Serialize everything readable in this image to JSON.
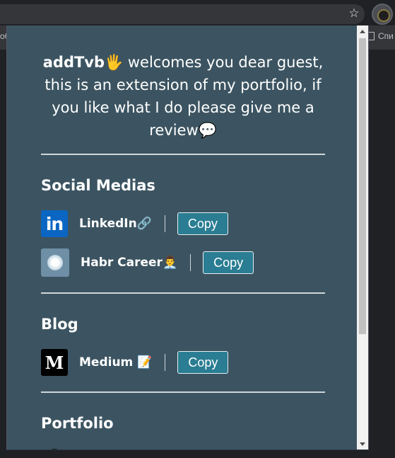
{
  "browser": {
    "bookmark_left_fragment": "об",
    "bookmark_right_label": "Спи"
  },
  "intro": {
    "author": "addTvb",
    "author_emoji": "🖐",
    "text": " welcomes you dear guest, this is an extension of my portfolio, if you like what I do please give me a review",
    "end_emoji": "💬"
  },
  "sections": {
    "social": {
      "title": "Social Medias",
      "items": [
        {
          "label": "LinkedIn🔗",
          "copy_label": "Copy",
          "logo_text": "in"
        },
        {
          "label": "Habr Career👨‍💼",
          "copy_label": "Copy"
        }
      ]
    },
    "blog": {
      "title": "Blog",
      "items": [
        {
          "label": "Medium 📝",
          "copy_label": "Copy",
          "logo_text": "M"
        }
      ]
    },
    "portfolio": {
      "title": "Portfolio"
    }
  },
  "colors": {
    "popup_background": "#3c5461",
    "button_background": "#2a7d92",
    "linkedin_blue": "#0a66c2"
  }
}
